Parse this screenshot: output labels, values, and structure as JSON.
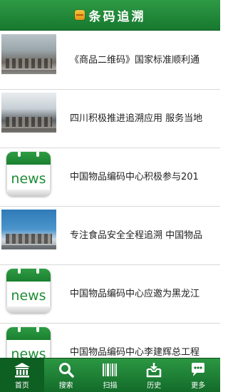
{
  "header": {
    "title": "条码追溯",
    "logo_icon": "app-logo-icon"
  },
  "articles": [
    {
      "title": "《商品二维码》国家标准顺利通",
      "thumb": "photo"
    },
    {
      "title": "四川积极推进追溯应用 服务当地",
      "thumb": "photo"
    },
    {
      "title": "中国物品编码中心积极参与201",
      "thumb": "news"
    },
    {
      "title": "专注食品安全全程追溯 中国物品",
      "thumb": "photo"
    },
    {
      "title": "中国物品编码中心应邀为黑龙江",
      "thumb": "news"
    },
    {
      "title": "中国物品编码中心李建辉总工程",
      "thumb": "news"
    }
  ],
  "news_icon_text": "news",
  "tabbar": {
    "items": [
      {
        "label": "首页",
        "icon": "home-icon",
        "active": true
      },
      {
        "label": "搜索",
        "icon": "search-icon",
        "active": false
      },
      {
        "label": "扫描",
        "icon": "barcode-icon",
        "active": false
      },
      {
        "label": "历史",
        "icon": "history-icon",
        "active": false
      },
      {
        "label": "更多",
        "icon": "more-icon",
        "active": false
      }
    ]
  },
  "colors": {
    "brand_green": "#1f8d37",
    "active_tab": "#0e5f22"
  }
}
